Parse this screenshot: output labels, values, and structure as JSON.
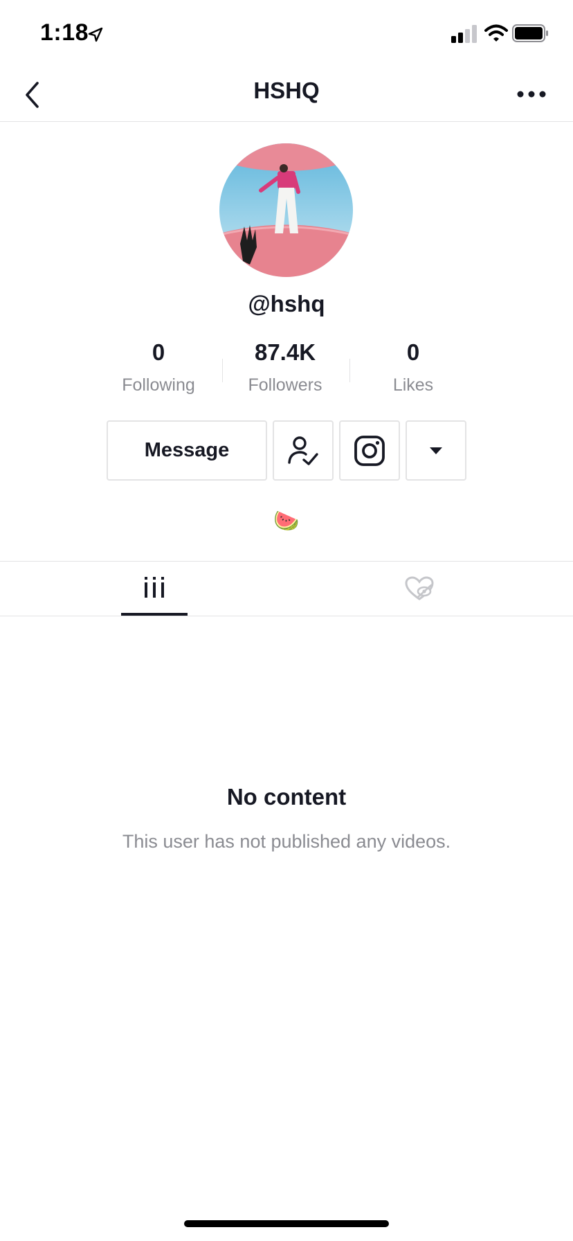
{
  "status_bar": {
    "time": "1:18",
    "icons": [
      "location-arrow-icon",
      "cellular-signal-icon",
      "wifi-icon",
      "battery-icon"
    ]
  },
  "nav": {
    "title": "HSHQ",
    "back_icon": "chevron-left-icon",
    "more_icon": "ellipsis-icon"
  },
  "profile": {
    "username": "@hshq",
    "bio": "🍉"
  },
  "stats": {
    "following": {
      "value": "0",
      "label": "Following"
    },
    "followers": {
      "value": "87.4K",
      "label": "Followers"
    },
    "likes": {
      "value": "0",
      "label": "Likes"
    }
  },
  "actions": {
    "message_label": "Message",
    "followed_icon": "user-check-icon",
    "instagram_icon": "instagram-icon",
    "more_icon": "caret-down-icon"
  },
  "tabs": [
    {
      "name": "videos",
      "icon": "grid-columns-icon",
      "active": true
    },
    {
      "name": "liked",
      "icon": "heart-hidden-icon",
      "active": false
    }
  ],
  "empty_state": {
    "title": "No content",
    "description": "This user has not published any videos."
  },
  "colors": {
    "text_primary": "#161823",
    "text_secondary": "#8a8b91",
    "border": "#e3e3e4",
    "background": "#ffffff"
  }
}
